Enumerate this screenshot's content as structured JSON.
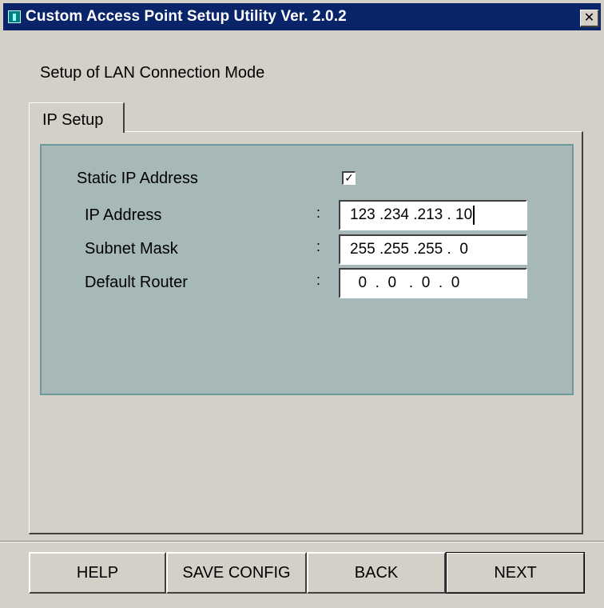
{
  "window": {
    "title": "Custom Access Point Setup Utility  Ver. 2.0.2",
    "close_label": "✕"
  },
  "page": {
    "heading": "Setup of LAN Connection Mode"
  },
  "tabs": [
    {
      "label": "IP Setup",
      "active": true
    }
  ],
  "ip_setup": {
    "static_ip_label": "Static IP Address",
    "static_ip_checked": true,
    "check_mark": "✓",
    "separator": ":",
    "fields": [
      {
        "label": "IP Address",
        "value": "123 .234 .213 . 10"
      },
      {
        "label": "Subnet Mask",
        "value": "255 .255 .255 .  0"
      },
      {
        "label": "Default Router",
        "value": "  0  .  0   .  0  .  0"
      }
    ]
  },
  "buttons": {
    "help": "HELP",
    "save": "SAVE CONFIG",
    "back": "BACK",
    "next": "NEXT"
  },
  "colors": {
    "titlebar": "#0a246a",
    "window_bg": "#d4d0c8",
    "group_bg": "#a6b8b8",
    "group_border": "#6b9a9e"
  }
}
